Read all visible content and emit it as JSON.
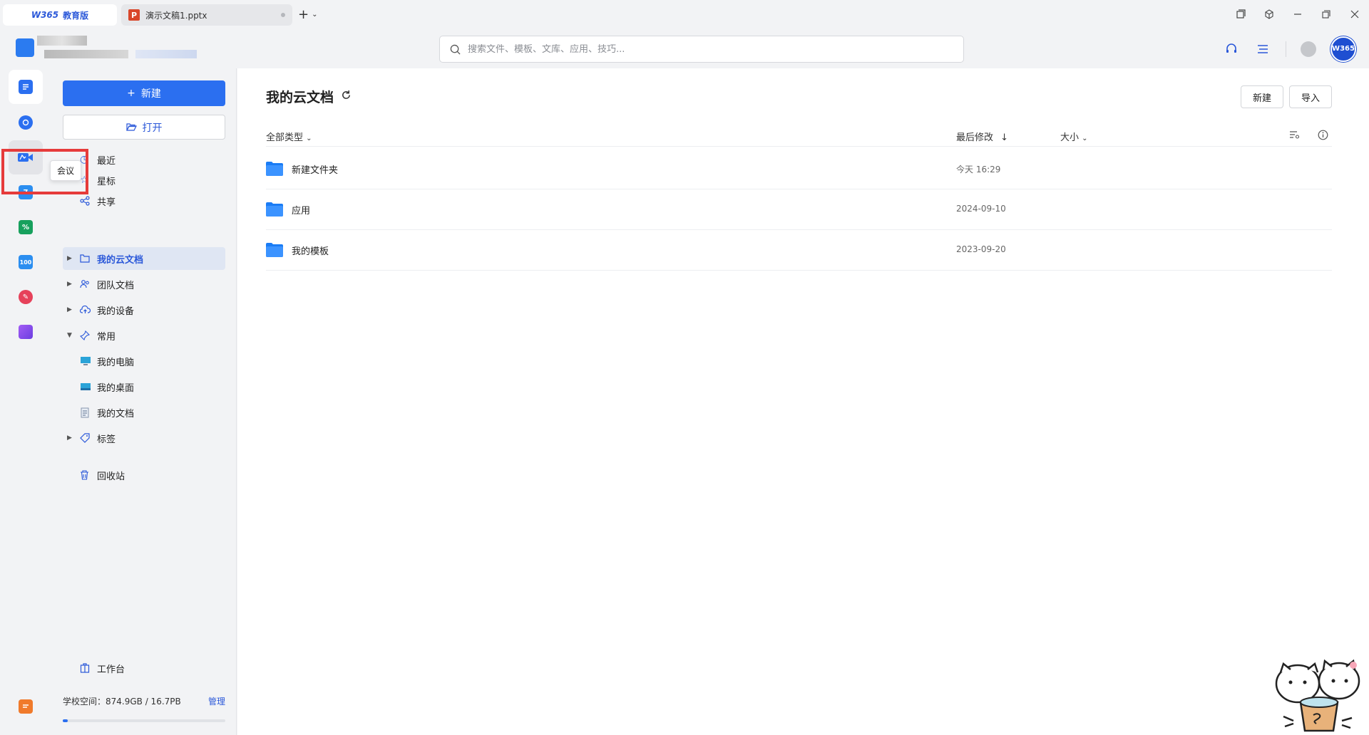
{
  "titlebar": {
    "home_tab": "教育版",
    "home_logo": "W365",
    "doc_tab": "演示文稿1.pptx",
    "ppt_badge": "P"
  },
  "header": {
    "search_placeholder": "搜索文件、模板、文库、应用、技巧...",
    "avatar_text": "365"
  },
  "rail": {
    "tooltip": "会议"
  },
  "sidebar": {
    "new_label": "新建",
    "open_label": "打开",
    "nav": {
      "recent": "最近",
      "starred": "星标",
      "shared": "共享",
      "my_cloud": "我的云文档",
      "team_docs": "团队文档",
      "my_devices": "我的设备",
      "common": "常用",
      "my_computer": "我的电脑",
      "my_desktop": "我的桌面",
      "my_documents": "我的文档",
      "tags": "标签",
      "trash": "回收站",
      "workbench": "工作台"
    },
    "storage": {
      "label": "学校空间：874.9GB / 16.7PB",
      "manage": "管理",
      "used_fraction": 0.03
    }
  },
  "main": {
    "title": "我的云文档",
    "new_btn": "新建",
    "import_btn": "导入",
    "columns": {
      "type_filter": "全部类型",
      "modified": "最后修改",
      "size": "大小"
    },
    "rows": [
      {
        "name": "新建文件夹",
        "date": "今天 16:29"
      },
      {
        "name": "应用",
        "date": "2024-09-10"
      },
      {
        "name": "我的模板",
        "date": "2023-09-20"
      }
    ]
  },
  "colors": {
    "accent": "#2b6ff0",
    "highlight": "#e63b3b",
    "folder": "#1a7cf5"
  }
}
